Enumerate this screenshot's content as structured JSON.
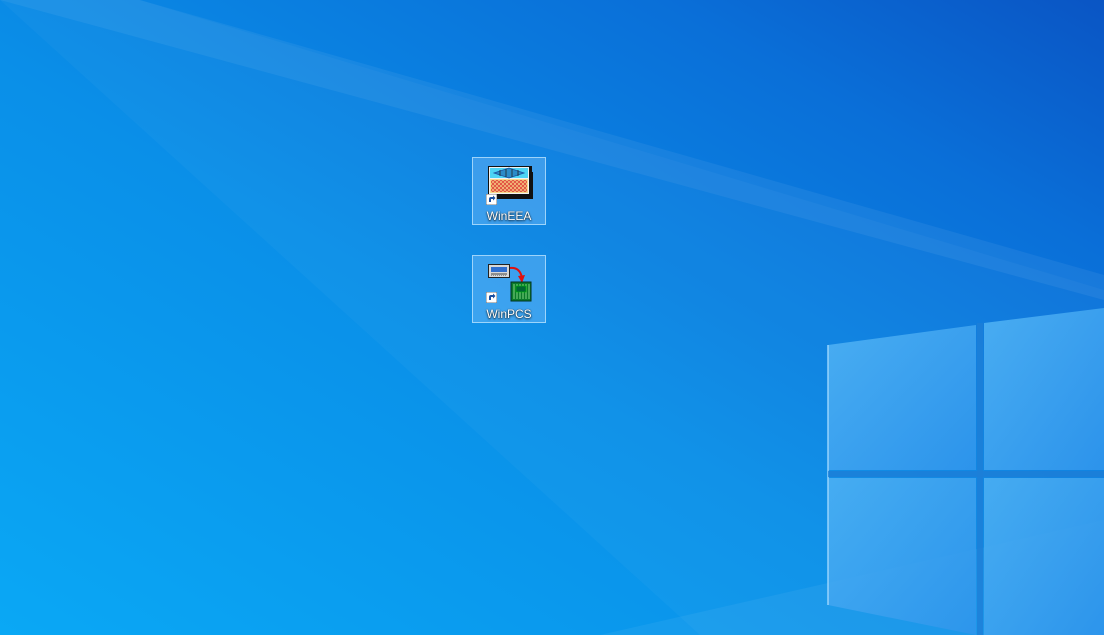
{
  "desktop": {
    "icons": [
      {
        "label": "WinEEA",
        "icon": "wineea-app-icon",
        "shortcut": true
      },
      {
        "label": "WinPCS",
        "icon": "winpcs-app-icon",
        "shortcut": true
      }
    ]
  },
  "colors": {
    "wallpaper_primary": "#0a8fe6",
    "wallpaper_dark": "#0a4fb8",
    "selection_fill": "#8cc8ff",
    "selection_border": "#bee6ff"
  }
}
